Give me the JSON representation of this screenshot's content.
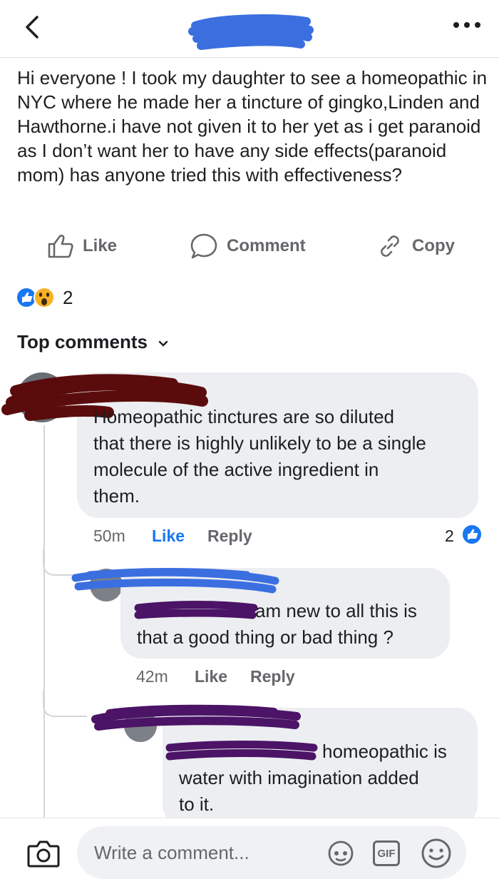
{
  "post": {
    "text": "Hi everyone ! I took my daughter to see a homeopathic in NYC where he made her a tincture of gingko,Linden and Hawthorne.i have not given it to her yet as i get paranoid as I don’t want her to have any side effects(paranoid mom) has anyone tried this with effectiveness?"
  },
  "actions": {
    "like": "Like",
    "comment": "Comment",
    "copy": "Copy"
  },
  "reactions": {
    "count": "2",
    "colors": {
      "like": "#1877f2",
      "wow": "#f7b125"
    }
  },
  "sort_label": "Top comments",
  "comments": [
    {
      "text_lines": [
        "Homeopathic tinctures are so diluted",
        "that there is highly unlikely to be a single",
        "molecule of the active ingredient in",
        "them."
      ],
      "time": "50m",
      "like": "Like",
      "reply": "Reply",
      "reaction_count": "2"
    },
    {
      "text_lines": [
        "am new to all this is",
        "that a good thing or bad thing ?"
      ],
      "time": "42m",
      "like": "Like",
      "reply": "Reply"
    },
    {
      "text_lines": [
        "homeopathic is",
        "water with imagination added",
        "to it."
      ]
    }
  ],
  "composer": {
    "placeholder": "Write a comment...",
    "gif_label": "GIF"
  },
  "colors": {
    "accent": "#1877f2",
    "redact_blue": "#3b6fe0",
    "redact_red": "#5a0c0c",
    "redact_purple": "#4b1466"
  }
}
